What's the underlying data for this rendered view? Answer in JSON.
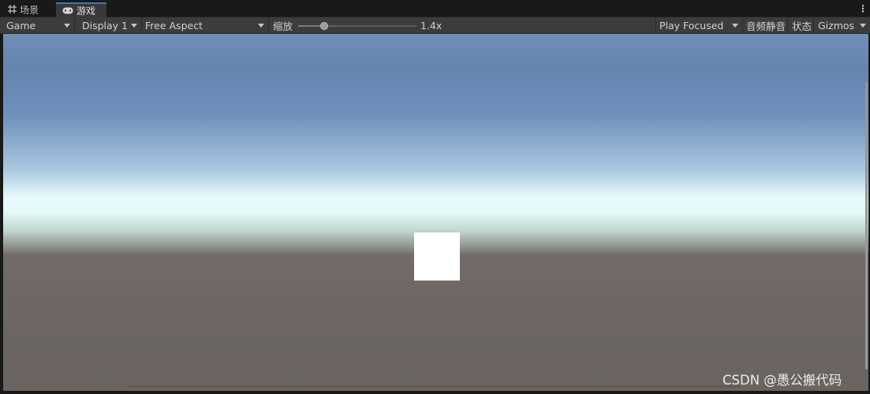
{
  "tabs": [
    {
      "label": "场景",
      "icon": "grid-icon",
      "active": false
    },
    {
      "label": "游戏",
      "icon": "gamepad-icon",
      "active": true
    }
  ],
  "tab_menu_icon": "kebab-menu-icon",
  "toolbar": {
    "view_select": "Game",
    "display_select": "Display 1",
    "aspect_select": "Free Aspect",
    "scale_label": "缩放",
    "scale_value": 0.22,
    "scale_text": "1.4x",
    "play_mode_select": "Play Focused",
    "mute_audio_label": "音频静音",
    "stats_label": "状态",
    "gizmos_label": "Gizmos"
  },
  "viewport": {
    "sky_color": "#6f8fb8",
    "horizon_color": "#e9fbfd",
    "ground_color": "#6e6764",
    "cube_color": "#ffffff"
  },
  "watermark": "CSDN @愚公搬代码",
  "colors": {
    "accent": "#3a79bb",
    "toolbar_bg": "#3c3c3c",
    "tabbar_bg": "#191919"
  }
}
